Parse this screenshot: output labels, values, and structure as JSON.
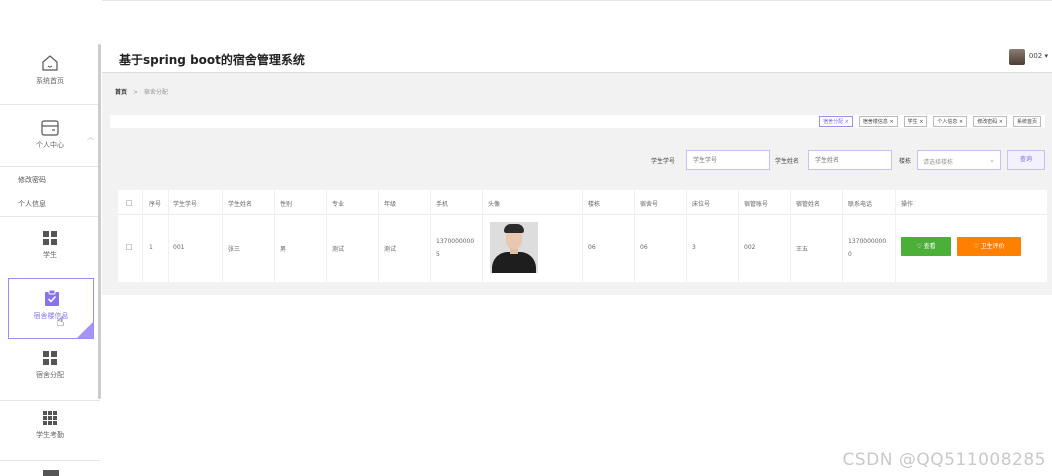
{
  "app": {
    "title": "基于spring boot的宿舍管理系统",
    "user": "002 ▾"
  },
  "sidebar": {
    "items": [
      {
        "label": "系统首页",
        "icon": "home-icon"
      },
      {
        "label": "个人中心",
        "icon": "wallet-icon"
      },
      {
        "label": "学生",
        "icon": "grid-icon"
      },
      {
        "label": "宿舍楼信息",
        "icon": "clipboard-check-icon"
      },
      {
        "label": "宿舍分配",
        "icon": "grid-icon"
      },
      {
        "label": "学生考勤",
        "icon": "grid9-icon"
      }
    ],
    "submenu": [
      "修改密码",
      "个人信息"
    ]
  },
  "breadcrumb": {
    "home": "首页",
    "sep": ">",
    "current": "宿舍分配"
  },
  "tags": [
    "宿舍分配 ×",
    "宿舍楼信息 ×",
    "学生 ×",
    "个人信息 ×",
    "修改密码 ×",
    "系统首页"
  ],
  "search": {
    "student_no_label": "学生学号",
    "student_no_placeholder": "学生学号",
    "student_name_label": "学生姓名",
    "student_name_placeholder": "学生姓名",
    "building_label": "楼栋",
    "building_placeholder": "请选择楼栋",
    "query_label": "查询"
  },
  "table": {
    "headers": [
      "序号",
      "学生学号",
      "学生姓名",
      "性别",
      "专业",
      "年级",
      "手机",
      "头像",
      "楼栋",
      "宿舍号",
      "床位号",
      "宿管账号",
      "宿管姓名",
      "联系电话",
      "操作"
    ],
    "rows": [
      {
        "index": "1",
        "student_no": "001",
        "name": "张三",
        "gender": "男",
        "major": "测试",
        "grade": "测试",
        "phone_1": "1370000000",
        "phone_2": "5",
        "building": "06",
        "room": "06",
        "bed": "3",
        "manager_account": "002",
        "manager_name": "王五",
        "contact_1": "1370000000",
        "contact_2": "0",
        "view_label": "♡ 查看",
        "eval_label": "♡ 卫生评价"
      }
    ]
  },
  "colors": {
    "accent": "#8a74ee",
    "view_button": "#4caf3a",
    "eval_button": "#ff8000"
  },
  "watermark": "CSDN @QQ511008285"
}
